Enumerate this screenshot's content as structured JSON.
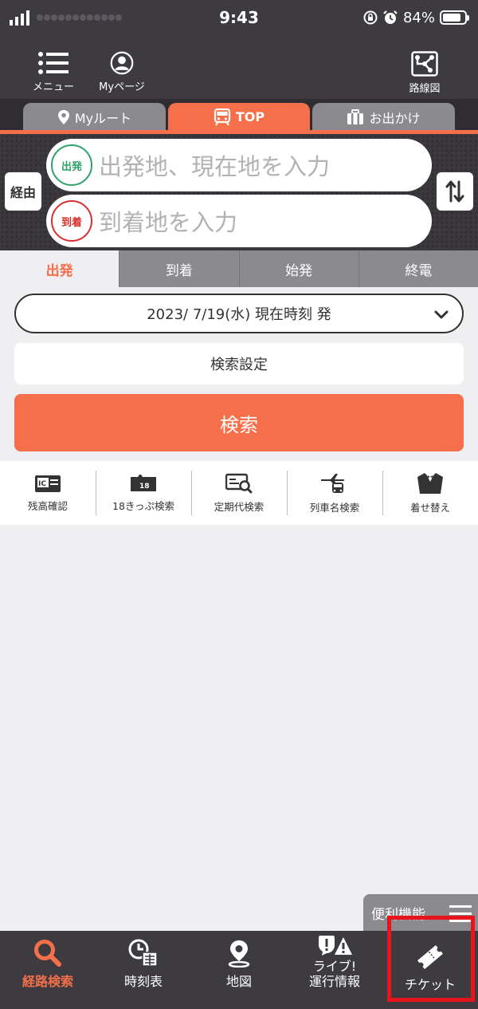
{
  "status_bar": {
    "time": "9:43",
    "battery": "84%",
    "battery_level": 0.84
  },
  "header": {
    "menu_label": "メニュー",
    "mypage_label": "Myページ",
    "routemap_label": "路線図"
  },
  "tabs": [
    {
      "label": "Myルート",
      "icon": "pin-icon"
    },
    {
      "label": "TOP",
      "icon": "train-icon",
      "active": true
    },
    {
      "label": "お出かけ",
      "icon": "luggage-icon"
    }
  ],
  "search": {
    "via_label": "経由",
    "departure_badge": "出発",
    "departure_placeholder": "出発地、現在地を入力",
    "arrival_badge": "到着",
    "arrival_placeholder": "到着地を入力",
    "departure_color": "#2fa36b",
    "arrival_color": "#d8302e"
  },
  "time_modes": [
    "出発",
    "到着",
    "始発",
    "終電"
  ],
  "date_selector": "2023/ 7/19(水) 現在時刻 発",
  "settings_label": "検索設定",
  "search_button": "検索",
  "tools": [
    {
      "label": "残高確認",
      "icon": "ic-card-icon"
    },
    {
      "label": "18きっぷ検索",
      "icon": "ticket18-icon",
      "icon_text": "18"
    },
    {
      "label": "定期代検索",
      "icon": "pass-search-icon"
    },
    {
      "label": "列車名検索",
      "icon": "plane-bus-icon"
    },
    {
      "label": "着せ替え",
      "icon": "suit-icon"
    }
  ],
  "benri_label": "便利機能",
  "bottom_nav": [
    {
      "label": "経路検索",
      "icon": "search-icon",
      "active": true
    },
    {
      "label": "時刻表",
      "icon": "timetable-icon"
    },
    {
      "label": "地図",
      "icon": "map-pin-icon"
    },
    {
      "label": "ライブ!\n運行情報",
      "label_line1": "ライブ!",
      "label_line2": "運行情報",
      "icon": "alert-icon"
    },
    {
      "label": "チケット",
      "icon": "ticket-icon"
    }
  ],
  "colors": {
    "accent": "#f5704a",
    "dark": "#3d3b40",
    "highlight": "#e8141b"
  }
}
